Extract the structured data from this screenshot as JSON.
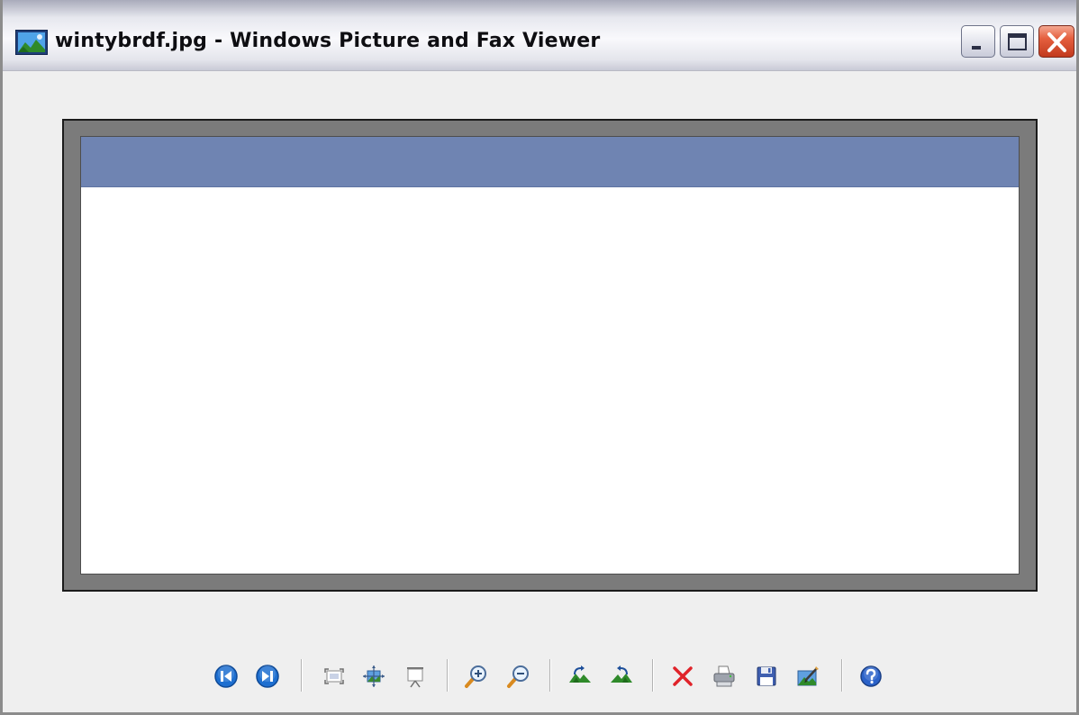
{
  "window": {
    "title": "wintybrdf.jpg - Windows Picture and Fax Viewer",
    "app_icon": "picture-viewer-icon"
  },
  "title_controls": [
    {
      "name": "minimize-button",
      "icon": "minimize-icon"
    },
    {
      "name": "maximize-button",
      "icon": "maximize-icon"
    },
    {
      "name": "close-button",
      "icon": "close-icon"
    }
  ],
  "image": {
    "banner_color": "#6f84b2",
    "body_color": "#ffffff",
    "frame_color": "#7b7b7b"
  },
  "toolbar": {
    "buttons": [
      {
        "name": "previous-image-button",
        "icon": "previous-icon",
        "tooltip": "Previous Image"
      },
      {
        "name": "next-image-button",
        "icon": "next-icon",
        "tooltip": "Next Image"
      },
      {
        "name": "best-fit-button",
        "icon": "best-fit-icon",
        "tooltip": "Best Fit"
      },
      {
        "name": "actual-size-button",
        "icon": "actual-size-icon",
        "tooltip": "Actual Size"
      },
      {
        "name": "slide-show-button",
        "icon": "slide-show-icon",
        "tooltip": "Start Slide Show"
      },
      {
        "name": "zoom-in-button",
        "icon": "zoom-in-icon",
        "tooltip": "Zoom In"
      },
      {
        "name": "zoom-out-button",
        "icon": "zoom-out-icon",
        "tooltip": "Zoom Out"
      },
      {
        "name": "rotate-clockwise-button",
        "icon": "rotate-clockwise-icon",
        "tooltip": "Rotate Clockwise"
      },
      {
        "name": "rotate-counterclockwise-button",
        "icon": "rotate-counterclockwise-icon",
        "tooltip": "Rotate Counterclockwise"
      },
      {
        "name": "delete-button",
        "icon": "delete-icon",
        "tooltip": "Delete"
      },
      {
        "name": "print-button",
        "icon": "print-icon",
        "tooltip": "Print"
      },
      {
        "name": "save-button",
        "icon": "save-icon",
        "tooltip": "Copy To"
      },
      {
        "name": "edit-button",
        "icon": "edit-icon",
        "tooltip": "Edit"
      },
      {
        "name": "help-button",
        "icon": "help-icon",
        "tooltip": "Help"
      }
    ]
  }
}
